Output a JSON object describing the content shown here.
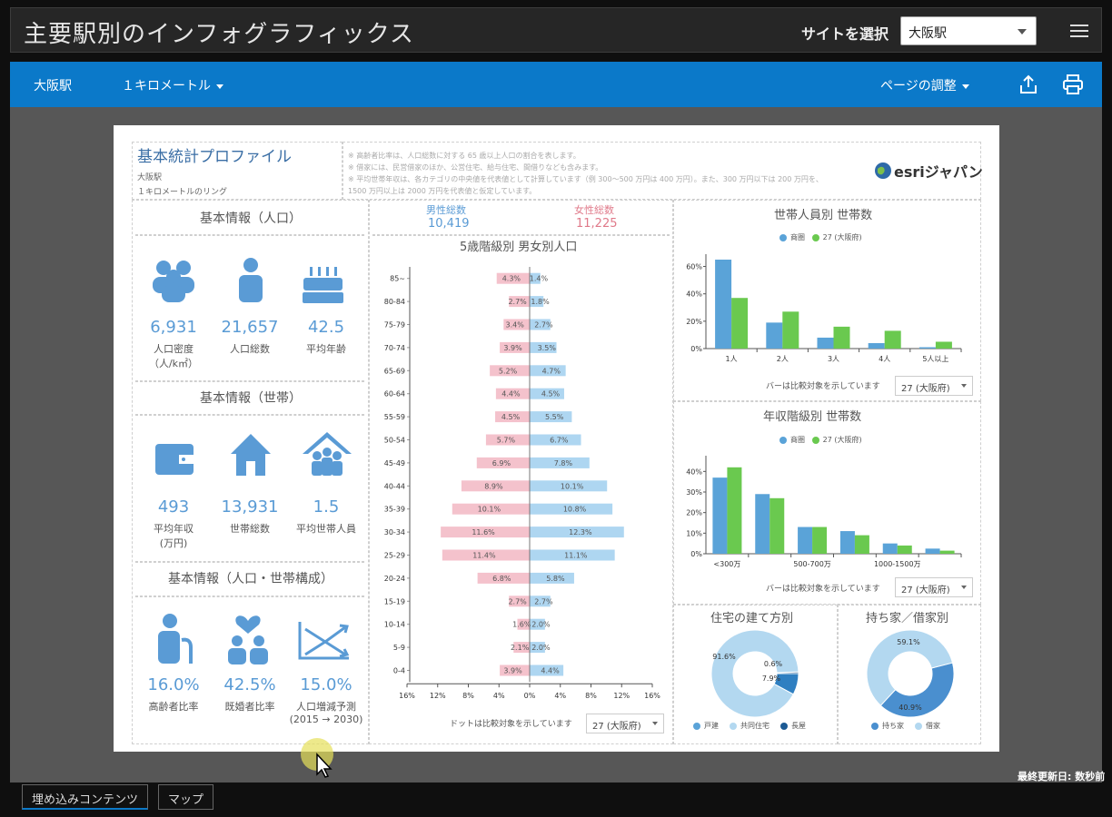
{
  "app": {
    "title": "主要駅別のインフォグラフィックス",
    "site_label": "サイトを選択",
    "site_value": "大阪駅"
  },
  "toolbar": {
    "station": "大阪駅",
    "radius": "１キロメートル",
    "page_adjust": "ページの調整"
  },
  "report": {
    "title": "基本統計プロファイル",
    "place": "大阪駅",
    "ring": "１キロメートルのリング",
    "notes": [
      "※ 高齢者比率は、人口総数に対する 65 歳以上人口の割合を表します。",
      "※ 借家には、民営借家のほか、公営住宅、給与住宅、間借りなども含みます。",
      "※ 平均世帯年収は、各カテゴリの中央値を代表値として計算しています（例 300～500 万円は 400 万円）。また、300 万円以下は 200 万円を、",
      "1500 万円以上は 2000 万円を代表値と仮定しています。"
    ],
    "logo": "esriジャパン",
    "sections": {
      "pop": "基本情報（人口）",
      "hh": "基本情報（世帯）",
      "comp": "基本情報（人口・世帯構成）"
    },
    "stats_pop": [
      {
        "value": "6,931",
        "label": "人口密度",
        "label2": "（人/k㎡）"
      },
      {
        "value": "21,657",
        "label": "人口総数",
        "label2": ""
      },
      {
        "value": "42.5",
        "label": "平均年齢",
        "label2": ""
      }
    ],
    "stats_hh": [
      {
        "value": "493",
        "label": "平均年収",
        "label2": "(万円)"
      },
      {
        "value": "13,931",
        "label": "世帯総数",
        "label2": ""
      },
      {
        "value": "1.5",
        "label": "平均世帯人員",
        "label2": ""
      }
    ],
    "stats_comp": [
      {
        "value": "16.0%",
        "label": "高齢者比率",
        "label2": ""
      },
      {
        "value": "42.5%",
        "label": "既婚者比率",
        "label2": ""
      },
      {
        "value": "15.0%",
        "label": "人口増減予測",
        "label2": "(2015 → 2030)"
      }
    ],
    "male_label": "男性総数",
    "male_total": "10,419",
    "female_label": "女性総数",
    "female_total": "11,225",
    "pyramid_title": "5歳階級別 男女別人口",
    "pyramid_note": "ドットは比較対象を示しています",
    "compare_value": "27 (大阪府)",
    "bar_note": "バーは比較対象を示しています",
    "hh_title": "世帯人員別 世帯数",
    "inc_title": "年収階級別 世帯数",
    "legend_a": "商圏",
    "legend_b": "27 (大阪府)",
    "house_title": "住宅の建て方別",
    "own_title": "持ち家／借家別",
    "house_legend": [
      "戸建",
      "共同住宅",
      "長屋"
    ],
    "own_legend": [
      "持ち家",
      "借家"
    ]
  },
  "chart_data": [
    {
      "type": "bar",
      "title": "5歳階級別 男女別人口",
      "categories": [
        "85~",
        "80-84",
        "75-79",
        "70-74",
        "65-69",
        "60-64",
        "55-59",
        "50-54",
        "45-49",
        "40-44",
        "35-39",
        "30-34",
        "25-29",
        "20-24",
        "15-19",
        "10-14",
        "5-9",
        "0-4"
      ],
      "series": [
        {
          "name": "男性総数",
          "values": [
            4.3,
            2.7,
            3.4,
            3.9,
            5.2,
            4.4,
            4.5,
            5.7,
            6.9,
            8.9,
            10.1,
            11.6,
            11.4,
            6.8,
            2.7,
            1.6,
            2.1,
            3.9
          ]
        },
        {
          "name": "女性総数",
          "values": [
            1.4,
            1.8,
            2.7,
            3.5,
            4.7,
            4.5,
            5.5,
            6.7,
            7.8,
            10.1,
            10.8,
            12.3,
            11.1,
            5.8,
            2.7,
            2.0,
            2.0,
            4.4
          ]
        }
      ],
      "xticks": [
        "16%",
        "12%",
        "8%",
        "4%",
        "0%",
        "4%",
        "8%",
        "12%",
        "16%"
      ],
      "xlim": [
        -16,
        16
      ]
    },
    {
      "type": "bar",
      "title": "世帯人員別 世帯数",
      "categories": [
        "1人",
        "2人",
        "3人",
        "4人",
        "5人以上"
      ],
      "series": [
        {
          "name": "商圏",
          "values": [
            65,
            19,
            8,
            4,
            1
          ]
        },
        {
          "name": "27 (大阪府)",
          "values": [
            37,
            27,
            16,
            13,
            5
          ]
        }
      ],
      "yticks": [
        "0%",
        "20%",
        "40%",
        "60%"
      ],
      "ylim": [
        0,
        65
      ]
    },
    {
      "type": "bar",
      "title": "年収階級別 世帯数",
      "categories": [
        "<300万",
        "",
        "500-700万",
        "",
        "1000-1500万",
        ""
      ],
      "series": [
        {
          "name": "商圏",
          "values": [
            37,
            29,
            13,
            11,
            5,
            2.5
          ]
        },
        {
          "name": "27 (大阪府)",
          "values": [
            42,
            27,
            13,
            9,
            4,
            1.5
          ]
        }
      ],
      "yticks": [
        "0%",
        "10%",
        "20%",
        "30%",
        "40%"
      ],
      "ylim": [
        0,
        45
      ]
    },
    {
      "type": "pie",
      "title": "住宅の建て方別",
      "categories": [
        "戸建",
        "共同住宅",
        "長屋"
      ],
      "values": [
        7.9,
        91.6,
        0.6
      ],
      "labels": [
        "7.9%",
        "91.6%",
        "0.6%"
      ]
    },
    {
      "type": "pie",
      "title": "持ち家／借家別",
      "categories": [
        "持ち家",
        "借家"
      ],
      "values": [
        40.9,
        59.1
      ],
      "labels": [
        "40.9%",
        "59.1%"
      ]
    }
  ],
  "colors": {
    "male": "#f4c2cc",
    "female": "#aed6f1",
    "a": "#5aa3d8",
    "b": "#6ac94f",
    "icon": "#5a9bd5",
    "blue": "#0b79c9"
  },
  "footer": {
    "updated": "最終更新日: 数秒前",
    "tab1": "埋め込みコンテンツ",
    "tab2": "マップ"
  }
}
